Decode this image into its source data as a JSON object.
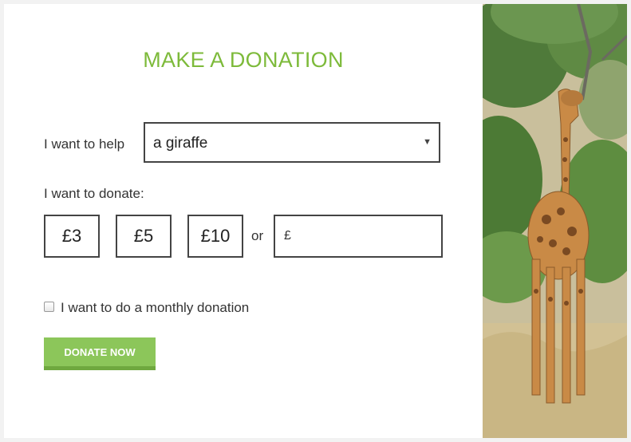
{
  "form": {
    "title": "MAKE A DONATION",
    "help_label": "I want to help",
    "help_select": {
      "selected": "a giraffe",
      "icon": "caret-down-icon"
    },
    "donate_label": "I want to donate:",
    "amounts": [
      "£3",
      "£5",
      "£10"
    ],
    "or_text": "or",
    "custom_amount": {
      "currency": "£",
      "value": "",
      "placeholder": ""
    },
    "monthly": {
      "label": "I want to do a monthly donation",
      "checked": false
    },
    "submit_label": "DONATE NOW"
  },
  "photo": {
    "subject": "giraffe"
  },
  "colors": {
    "accent": "#7dba3a",
    "button": "#8cc65a",
    "button_shadow": "#6fa83f",
    "border": "#444444"
  }
}
